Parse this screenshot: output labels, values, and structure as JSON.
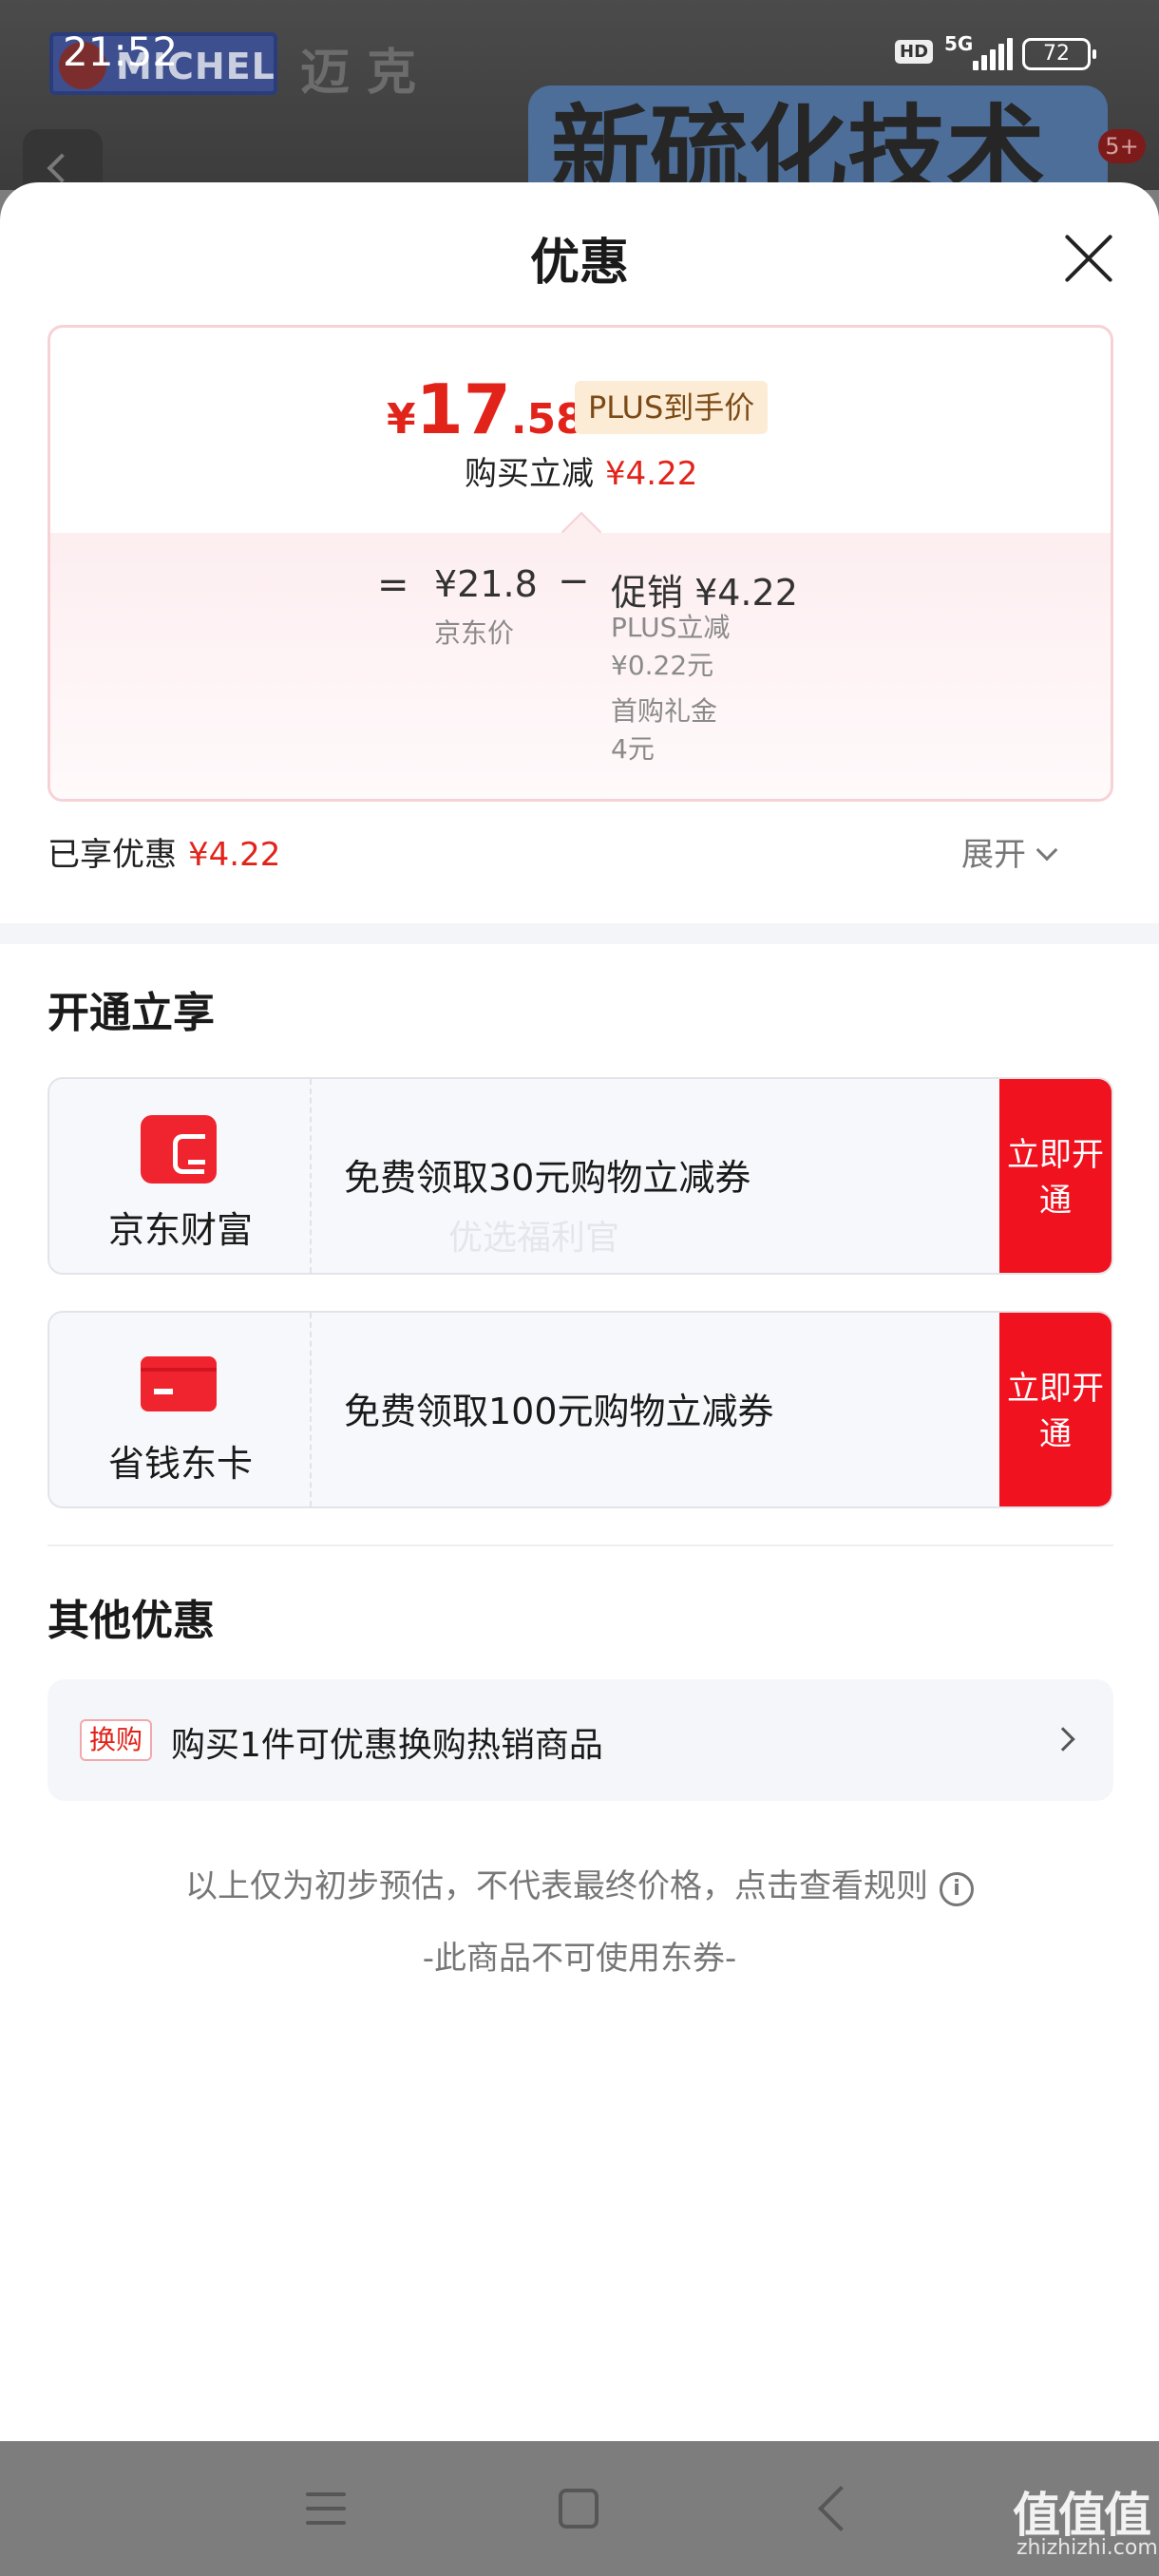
{
  "status_bar": {
    "time": "21:52",
    "hd": "HD",
    "network": "5G",
    "battery": "72"
  },
  "background_page": {
    "logo_text": "MICHEL",
    "brand_text": "迈克",
    "banner_text": "新硫化技术",
    "badge": "5+"
  },
  "sheet": {
    "title": "优惠"
  },
  "price_card": {
    "currency": "¥",
    "price_int": "17",
    "price_dec": ".58",
    "plus_tag": "PLUS到手价",
    "reduce_label": "购买立减",
    "reduce_amount": "¥4.22",
    "equals": "=",
    "jd_price": "¥21.8",
    "jd_price_label": "京东价",
    "minus": "−",
    "promo_label": "促销 ¥4.22",
    "plus_reduce_label": "PLUS立减",
    "plus_reduce_amount": "¥0.22元",
    "first_gift_label": "首购礼金",
    "first_gift_amount": "4元"
  },
  "enjoyed": {
    "label": "已享优惠",
    "amount": "¥4.22",
    "expand_label": "展开"
  },
  "open_section": {
    "title": "开通立享",
    "offers": [
      {
        "name": "京东财富",
        "desc": "免费领取30元购物立减券",
        "button": "立即开通"
      },
      {
        "name": "省钱东卡",
        "desc": "免费领取100元购物立减券",
        "button": "立即开通"
      }
    ],
    "watermark": "优选福利官"
  },
  "other_section": {
    "title": "其他优惠",
    "tag": "换购",
    "text": "购买1件可优惠换购热销商品"
  },
  "footer": {
    "disclaimer": "以上仅为初步预估，不代表最终价格，点击查看规则",
    "info_icon": "i",
    "no_coupon": "-此商品不可使用东券-"
  },
  "watermark_logo": {
    "text": "值值值",
    "sub": "zhizhizhi.com"
  },
  "colors": {
    "accent_red": "#e2231a",
    "button_red": "#f0121f",
    "plus_tag_bg": "#fcecd5"
  },
  "icons": [
    "close-icon",
    "chevron-down-icon",
    "wealth-icon",
    "card-icon",
    "chevron-right-icon",
    "info-icon",
    "menu-icon",
    "home-icon",
    "back-icon"
  ]
}
